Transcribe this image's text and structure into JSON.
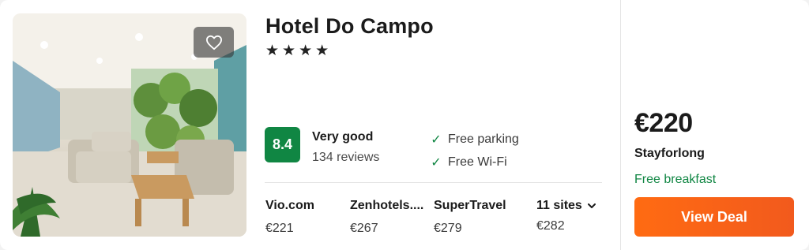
{
  "hotel": {
    "name": "Hotel Do Campo",
    "stars": 4,
    "star_glyph": "★",
    "favorite_icon": "heart-outline-icon"
  },
  "rating": {
    "score": "8.4",
    "label": "Very good",
    "reviews": "134 reviews",
    "badge_color": "#108643"
  },
  "amenities": [
    {
      "icon": "check-icon",
      "label": "Free parking"
    },
    {
      "icon": "check-icon",
      "label": "Free Wi-Fi"
    }
  ],
  "sites": [
    {
      "name": "Vio.com",
      "price": "€221"
    },
    {
      "name": "Zenhotels....",
      "price": "€267"
    },
    {
      "name": "SuperTravel",
      "price": "€279"
    }
  ],
  "more_sites": {
    "label": "11 sites",
    "icon": "chevron-down-icon",
    "price": "€282"
  },
  "deal": {
    "price": "€220",
    "provider": "Stayforlong",
    "perk": "Free breakfast",
    "button_label": "View Deal",
    "button_color": "#ff6b12",
    "perk_color": "#108643"
  }
}
